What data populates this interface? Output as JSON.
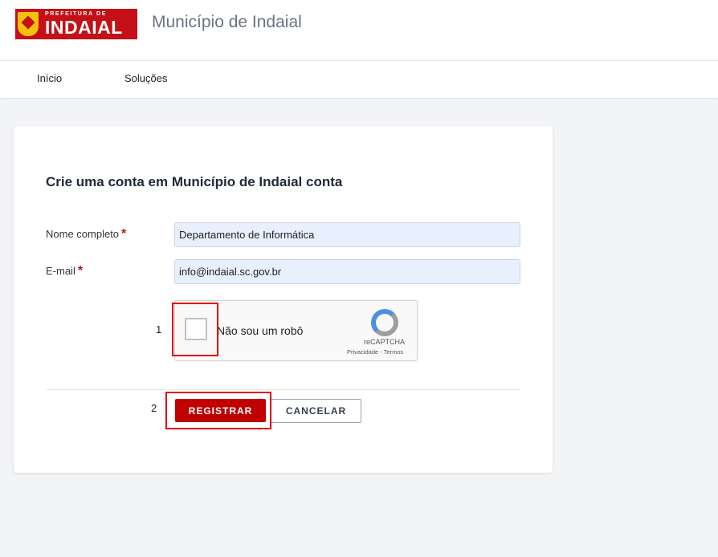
{
  "header": {
    "logo_small": "PREFEITURA DE",
    "logo_big": "INDAIAL",
    "site_title": "Município de Indaial"
  },
  "nav": {
    "items": [
      {
        "label": "Início"
      },
      {
        "label": "Soluções"
      }
    ]
  },
  "form": {
    "title": "Crie uma conta em Município de Indaial conta",
    "name_label": "Nome completo",
    "name_value": "Departamento de Informática",
    "email_label": "E-mail",
    "email_value": "info@indaial.sc.gov.br",
    "required_mark": "*",
    "recaptcha": {
      "label": "Não sou um robô",
      "brand": "reCAPTCHA",
      "links": "Privacidade - Termos"
    },
    "register_label": "REGISTRAR",
    "cancel_label": "CANCELAR"
  },
  "annotations": {
    "step1": "1",
    "step2": "2",
    "highlight_color": "#e00000"
  },
  "colors": {
    "brand": "#c41016",
    "primary_button": "#c00000",
    "input_bg": "#e8f0fe"
  }
}
